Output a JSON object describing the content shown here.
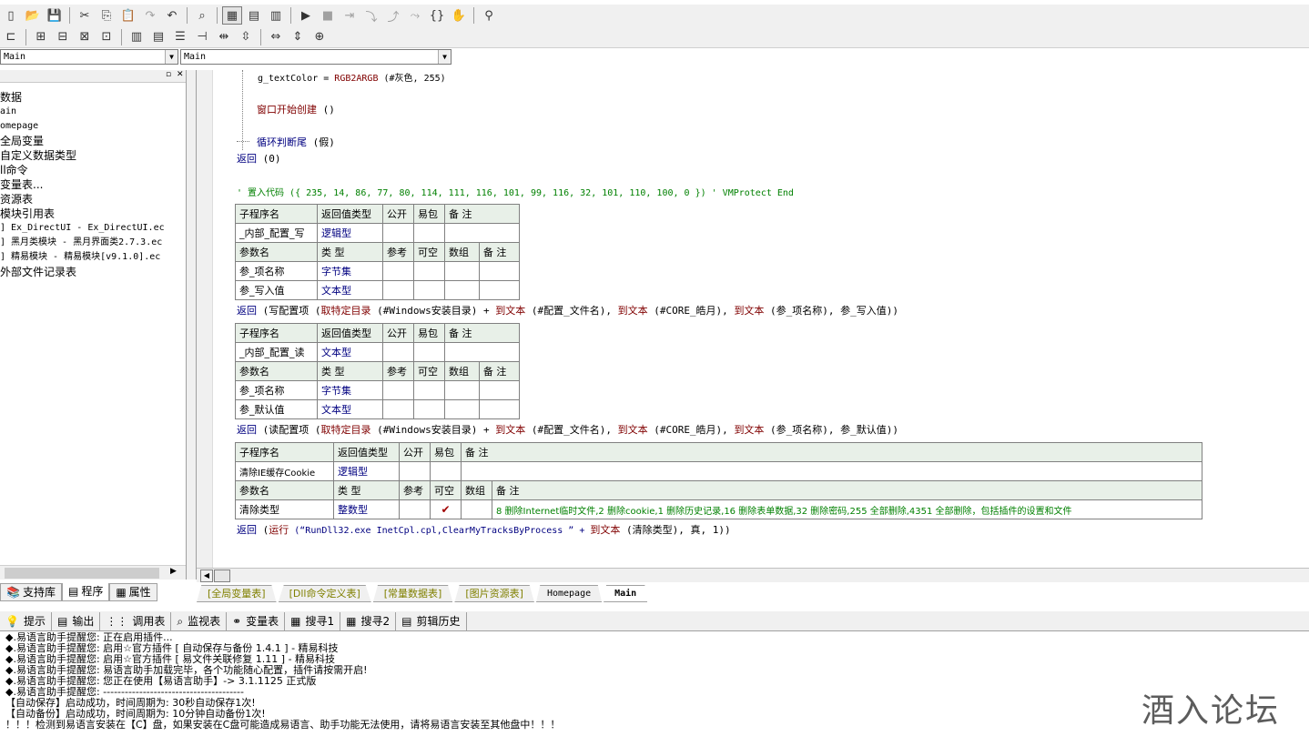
{
  "toolbar1": [
    {
      "name": "new-file-icon",
      "glyph": "▯"
    },
    {
      "name": "open-icon",
      "glyph": "📂"
    },
    {
      "name": "save-icon",
      "glyph": "💾"
    },
    {
      "sep": true
    },
    {
      "name": "cut-icon",
      "glyph": "✂"
    },
    {
      "name": "copy-icon",
      "glyph": "⎘"
    },
    {
      "name": "paste-icon",
      "glyph": "📋",
      "dim": true
    },
    {
      "name": "redo-icon",
      "glyph": "↷",
      "dim": true
    },
    {
      "name": "undo-icon",
      "glyph": "↶"
    },
    {
      "sep": true
    },
    {
      "name": "find-icon",
      "glyph": "⌕"
    },
    {
      "sep": true
    },
    {
      "name": "layout1-icon",
      "glyph": "▦",
      "pressed": true
    },
    {
      "name": "layout2-icon",
      "glyph": "▤"
    },
    {
      "name": "layout3-icon",
      "glyph": "▥"
    },
    {
      "sep": true
    },
    {
      "name": "run-icon",
      "glyph": "▶"
    },
    {
      "name": "stop-icon",
      "glyph": "■",
      "dim": true
    },
    {
      "name": "step-icon",
      "glyph": "⇥",
      "dim": true
    },
    {
      "name": "step-into-icon",
      "glyph": "⤵",
      "dim": true
    },
    {
      "name": "step-out-icon",
      "glyph": "⤴",
      "dim": true
    },
    {
      "name": "step-over-icon",
      "glyph": "⤳",
      "dim": true
    },
    {
      "name": "brace-icon",
      "glyph": "{}"
    },
    {
      "name": "hand-icon",
      "glyph": "✋"
    },
    {
      "sep": true
    },
    {
      "name": "binoculars-icon",
      "glyph": "⚲"
    }
  ],
  "toolbar2": [
    {
      "name": "align-left-icon",
      "glyph": "⊏"
    },
    {
      "sep": true
    },
    {
      "name": "align-v1-icon",
      "glyph": "⊞"
    },
    {
      "name": "align-v2-icon",
      "glyph": "⊟"
    },
    {
      "name": "align-v3-icon",
      "glyph": "⊠"
    },
    {
      "name": "align-v4-icon",
      "glyph": "⊡"
    },
    {
      "sep": true
    },
    {
      "name": "align-h1-icon",
      "glyph": "▥"
    },
    {
      "name": "align-h2-icon",
      "glyph": "▤"
    },
    {
      "name": "align-h3-icon",
      "glyph": "☰"
    },
    {
      "name": "align-h4-icon",
      "glyph": "⊣"
    },
    {
      "name": "space-h-icon",
      "glyph": "⇹"
    },
    {
      "name": "space-v-icon",
      "glyph": "⇳"
    },
    {
      "sep": true
    },
    {
      "name": "size-w-icon",
      "glyph": "⇔"
    },
    {
      "name": "size-h-icon",
      "glyph": "⇕"
    },
    {
      "name": "size-both-icon",
      "glyph": "⊕"
    }
  ],
  "combos": {
    "left": "Main",
    "right": "Main"
  },
  "tree": {
    "items": [
      {
        "label": "数据",
        "small": false
      },
      {
        "label": "ain",
        "small": true
      },
      {
        "label": "omepage",
        "small": true
      },
      {
        "label": "全局变量",
        "small": false
      },
      {
        "label": "自定义数据类型",
        "small": false
      },
      {
        "label": "ll命令",
        "small": false
      },
      {
        "label": "变量表...",
        "small": false
      },
      {
        "label": "资源表",
        "small": false
      },
      {
        "label": "模块引用表",
        "small": false
      },
      {
        "label": "] Ex_DirectUI - Ex_DirectUI.ec",
        "small": true
      },
      {
        "label": "] 黑月类模块 - 黑月界面类2.7.3.ec",
        "small": true
      },
      {
        "label": "] 精易模块 - 精易模块[v9.1.0].ec",
        "small": true
      },
      {
        "label": "外部文件记录表",
        "small": false
      }
    ]
  },
  "left_tabs": [
    {
      "label": "支持库",
      "icon": "📚"
    },
    {
      "label": "程序",
      "icon": "▤"
    },
    {
      "label": "属性",
      "icon": "▦"
    }
  ],
  "code": {
    "l1": {
      "a": "g_textColor = ",
      "b": "RGB2ARGB",
      "c": " (#灰色, 255)"
    },
    "l2": {
      "a": "窗口开始创建",
      "b": " ()"
    },
    "l3": {
      "a": "循环判断尾",
      "b": " (假)"
    },
    "l4": {
      "a": "返回",
      "b": " (0)"
    },
    "l5": "' 置入代码 ({ 235, 14, 86, 77, 80, 114, 111, 116, 101, 99, 116, 32, 101, 110, 100, 0 }) ' VMProtect End",
    "ret1": {
      "a": "返回",
      "b": " (写配置项 (",
      "c": "取特定目录",
      "d": " (#Windows安装目录) + ",
      "e": "到文本",
      "f": " (#配置_文件名), ",
      "g": "到文本",
      "h": " (#CORE_皓月), ",
      "i": "到文本",
      "j": " (参_项名称), 参_写入值))"
    },
    "ret2": {
      "a": "返回",
      "b": " (读配置项 (",
      "c": "取特定目录",
      "d": " (#Windows安装目录) + ",
      "e": "到文本",
      "f": " (#配置_文件名), ",
      "g": "到文本",
      "h": " (#CORE_皓月), ",
      "i": "到文本",
      "j": " (参_项名称), 参_默认值))"
    },
    "ret3": {
      "a": "返回",
      "b": " (",
      "c": "运行",
      "d": " (“RunDll32.exe InetCpl.cpl,ClearMyTracksByProcess ” + ",
      "e": "到文本",
      "f": " (清除类型), 真, 1))"
    }
  },
  "hdr": {
    "subname": "子程序名",
    "rettype": "返回值类型",
    "public": "公开",
    "easy": "易包",
    "note": "备 注",
    "param": "参数名",
    "type": "类 型",
    "ref": "参考",
    "opt": "可空",
    "arr": "数组"
  },
  "sub1": {
    "name": "_内部_配置_写",
    "ret": "逻辑型",
    "p1": "参_项名称",
    "t1": "字节集",
    "p2": "参_写入值",
    "t2": "文本型"
  },
  "sub2": {
    "name": "_内部_配置_读",
    "ret": "文本型",
    "p1": "参_项名称",
    "t1": "字节集",
    "p2": "参_默认值",
    "t2": "文本型"
  },
  "sub3": {
    "name": "清除IE缓存Cookie",
    "ret": "逻辑型",
    "p1": "清除类型",
    "t1": "整数型",
    "check": "✔",
    "note": "8 删除Internet临时文件,2 删除cookie,1 删除历史记录,16 删除表单数据,32 删除密码,255 全部删除,4351 全部删除，包括插件的设置和文件"
  },
  "sheet_tabs": [
    {
      "label": "[全局变量表]",
      "cls": ""
    },
    {
      "label": "[Dll命令定义表]",
      "cls": ""
    },
    {
      "label": "[常量数据表]",
      "cls": ""
    },
    {
      "label": "[图片资源表]",
      "cls": ""
    },
    {
      "label": "Homepage",
      "cls": "plain"
    },
    {
      "label": "Main",
      "cls": "active"
    }
  ],
  "out_tabs": [
    {
      "label": "提示",
      "icon": "💡"
    },
    {
      "label": "输出",
      "icon": "▤"
    },
    {
      "label": "调用表",
      "icon": "⋮⋮"
    },
    {
      "label": "监视表",
      "icon": "⌕"
    },
    {
      "label": "变量表",
      "icon": "⚭"
    },
    {
      "label": "搜寻1",
      "icon": "▦"
    },
    {
      "label": "搜寻2",
      "icon": "▦"
    },
    {
      "label": "剪辑历史",
      "icon": "▤"
    }
  ],
  "output": [
    "◆.易语言助手提醒您: 正在启用插件...",
    "◆.易语言助手提醒您: 启用☆官方插件 [ 自动保存与备份 1.4.1 ] - 精易科技",
    "◆.易语言助手提醒您: 启用☆官方插件 [ 易文件关联修复 1.11 ] - 精易科技",
    "◆.易语言助手提醒您: 易语言助手加载完毕，各个功能随心配置，插件请按需开启!",
    "◆.易语言助手提醒您: 您正在使用【易语言助手】-> 3.1.1125 正式版",
    "◆.易语言助手提醒您: ---------------------------------------",
    "【自动保存】启动成功，时间周期为: 30秒自动保存1次!",
    "【自动备份】启动成功，时间周期为: 10分钟自动备份1次!",
    "！！！检测到易语言安装在【C】盘，如果安装在C盘可能造成易语言、助手功能无法使用，请将易语言安装至其他盘中！！！"
  ],
  "watermark": "酒入论坛"
}
